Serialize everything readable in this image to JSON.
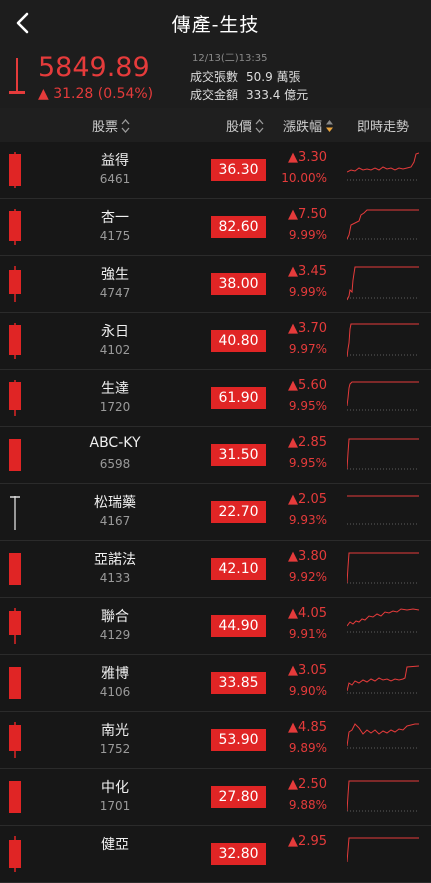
{
  "title": "傳產-生技",
  "index": {
    "value": "5849.89",
    "change": "▲ 31.28 (0.54%)",
    "datetime": "12/13(二)13:35",
    "volume_label": "成交張數",
    "volume_value": "50.9 萬張",
    "amount_label": "成交金額",
    "amount_value": "333.4 億元"
  },
  "columns": {
    "stock": "股票",
    "price": "股價",
    "change": "漲跌幅",
    "trend": "即時走勢"
  },
  "colors": {
    "up": "#e53b3b",
    "price_bg": "#e02525",
    "background": "#171717"
  },
  "icons": {
    "back": "chevron-left-icon",
    "sort": "sort-icon"
  },
  "rows": [
    {
      "name": "益得",
      "code": "6461",
      "price": "36.30",
      "change": "▲3.30",
      "pct": "10.00%"
    },
    {
      "name": "杏一",
      "code": "4175",
      "price": "82.60",
      "change": "▲7.50",
      "pct": "9.99%"
    },
    {
      "name": "強生",
      "code": "4747",
      "price": "38.00",
      "change": "▲3.45",
      "pct": "9.99%"
    },
    {
      "name": "永日",
      "code": "4102",
      "price": "40.80",
      "change": "▲3.70",
      "pct": "9.97%"
    },
    {
      "name": "生達",
      "code": "1720",
      "price": "61.90",
      "change": "▲5.60",
      "pct": "9.95%"
    },
    {
      "name": "ABC-KY",
      "code": "6598",
      "price": "31.50",
      "change": "▲2.85",
      "pct": "9.95%"
    },
    {
      "name": "松瑞藥",
      "code": "4167",
      "price": "22.70",
      "change": "▲2.05",
      "pct": "9.93%"
    },
    {
      "name": "亞諾法",
      "code": "4133",
      "price": "42.10",
      "change": "▲3.80",
      "pct": "9.92%"
    },
    {
      "name": "聯合",
      "code": "4129",
      "price": "44.90",
      "change": "▲4.05",
      "pct": "9.91%"
    },
    {
      "name": "雅博",
      "code": "4106",
      "price": "33.85",
      "change": "▲3.05",
      "pct": "9.90%"
    },
    {
      "name": "南光",
      "code": "1752",
      "price": "53.90",
      "change": "▲4.85",
      "pct": "9.89%"
    },
    {
      "name": "中化",
      "code": "1701",
      "price": "27.80",
      "change": "▲2.50",
      "pct": "9.88%"
    },
    {
      "name": "健亞",
      "code": "",
      "price": "32.80",
      "change": "▲2.95",
      "pct": ""
    }
  ]
}
